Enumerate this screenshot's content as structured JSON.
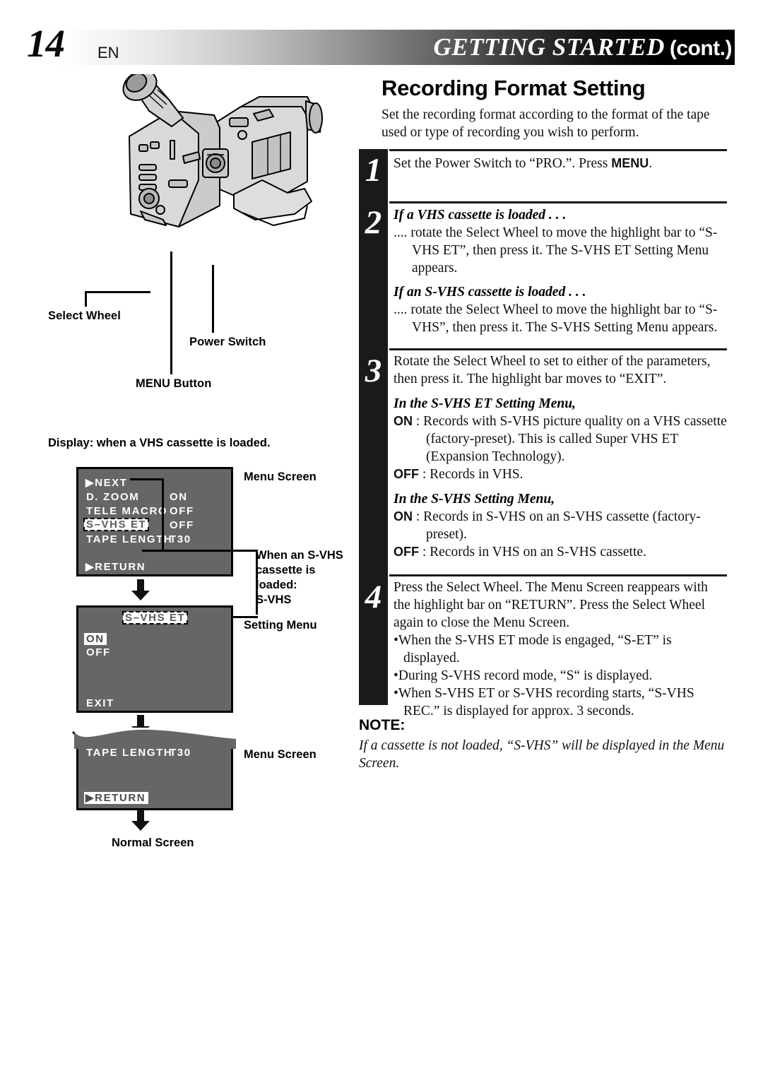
{
  "header": {
    "page_number": "14",
    "language_code": "EN",
    "title_main": "GETTING STARTED",
    "title_cont": "(cont.)"
  },
  "illustration": {
    "callouts": {
      "select_wheel": "Select Wheel",
      "power_switch": "Power Switch",
      "menu_button": "MENU Button"
    }
  },
  "display_section": {
    "caption": "Display: when a VHS cassette is loaded.",
    "labels": {
      "menu_screen_1": "Menu Screen",
      "setting_menu": "Setting Menu",
      "menu_screen_2": "Menu Screen",
      "normal_screen": "Normal Screen",
      "svhs_note_line1": "When an S-VHS",
      "svhs_note_line2": "cassette is loaded:",
      "svhs_note_line3": "S-VHS"
    },
    "screen1": {
      "rows": [
        {
          "label": "▶NEXT",
          "value": ""
        },
        {
          "label": "D. ZOOM",
          "value": "ON"
        },
        {
          "label": "TELE MACRO",
          "value": "OFF"
        },
        {
          "label": "S–VHS ET",
          "value": "OFF",
          "highlight": "dashed"
        },
        {
          "label": "TAPE LENGTH",
          "value": "T30"
        }
      ],
      "footer": "▶RETURN"
    },
    "screen2": {
      "title": "S–VHS ET",
      "options": [
        "ON",
        "OFF"
      ],
      "selected": "ON",
      "footer": "EXIT"
    },
    "screen3": {
      "row_label": "TAPE LENGTH",
      "row_value": "T30",
      "footer": "▶RETURN"
    }
  },
  "main": {
    "section_title": "Recording Format Setting",
    "intro": "Set the recording format according to the format of the tape used or type of recording you wish to perform.",
    "steps": [
      {
        "number": "1",
        "text_pre": "Set the Power Switch to “PRO.”. Press ",
        "bold": "MENU",
        "text_post": "."
      },
      {
        "number": "2",
        "sub1_heading": "If a VHS cassette is loaded . . .",
        "sub1_body": ".... rotate the Select Wheel to move the highlight bar to “S-VHS ET”, then press it. The S-VHS ET Setting Menu appears.",
        "sub2_heading": "If an S-VHS cassette is loaded . . .",
        "sub2_body": ".... rotate the Select Wheel to move the highlight bar to “S-VHS”, then press it. The S-VHS Setting Menu appears."
      },
      {
        "number": "3",
        "body": "Rotate the Select Wheel to set to either of the parameters, then press it. The highlight bar moves to “EXIT”.",
        "et_heading": "In the S-VHS ET Setting Menu,",
        "et_on_label": "ON",
        "et_on_text": ": Records with S-VHS picture quality on a VHS cassette (factory-preset). This is called Super VHS ET (Expansion Technology).",
        "et_off_label": "OFF",
        "et_off_text": ": Records in VHS.",
        "sv_heading": "In the S-VHS Setting Menu,",
        "sv_on_label": "ON",
        "sv_on_text": ":  Records in S-VHS on an S-VHS cassette (factory-preset).",
        "sv_off_label": "OFF",
        "sv_off_text": ": Records in VHS on an S-VHS cassette."
      },
      {
        "number": "4",
        "body": "Press the Select Wheel. The Menu Screen reappears with the highlight bar on “RETURN”. Press the Select Wheel again to close the Menu Screen.",
        "bullets": [
          "When the S-VHS ET mode is engaged, “S-ET” is displayed.",
          "During S-VHS record mode, “S“ is displayed.",
          "When S-VHS ET or S-VHS recording starts, “S-VHS REC.” is displayed for approx. 3 seconds."
        ]
      }
    ],
    "note_heading": "NOTE:",
    "note_body": "If a cassette is not loaded, “S-VHS” will be displayed in the Menu Screen."
  },
  "colors": {
    "osd_background": "#666666",
    "rail_black": "#1a1a1a",
    "body_ink": "#111111"
  }
}
